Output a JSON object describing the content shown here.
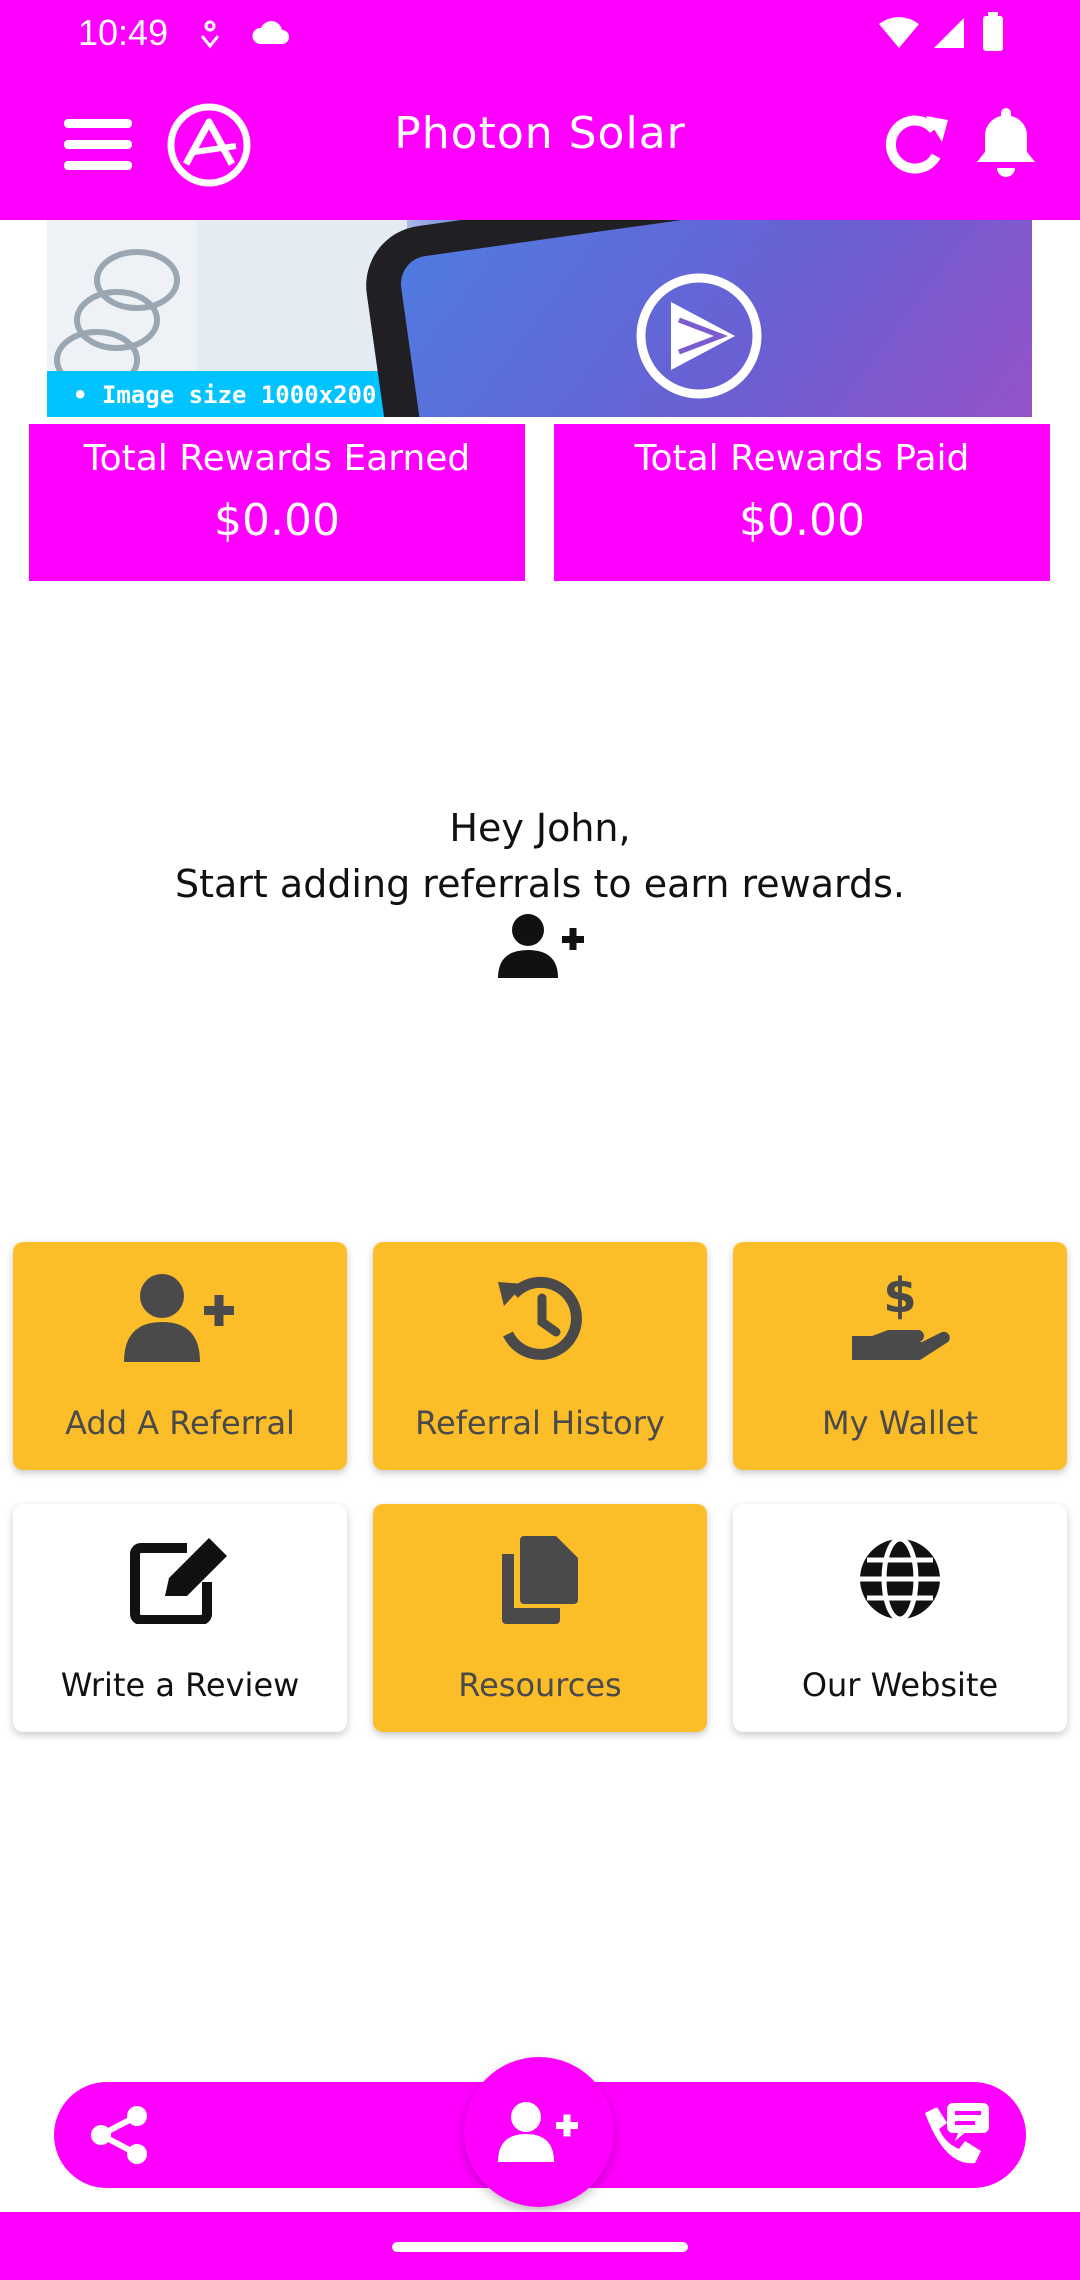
{
  "status_bar": {
    "time": "10:49"
  },
  "app_bar": {
    "title": "Photon Solar",
    "icons": [
      "menu-icon",
      "app-logo-icon",
      "refresh-icon",
      "bell-icon"
    ]
  },
  "banner": {
    "caption": "• Image size 1000x200"
  },
  "stats": [
    {
      "label": "Total Rewards Earned",
      "value": "$0.00"
    },
    {
      "label": "Total Rewards Paid",
      "value": "$0.00"
    }
  ],
  "greeting": {
    "line1": "Hey John,",
    "line2": "Start adding referrals to earn rewards."
  },
  "tiles": [
    {
      "label": "Add A Referral",
      "icon": "add-user-icon"
    },
    {
      "label": "Referral History",
      "icon": "history-icon"
    },
    {
      "label": "My Wallet",
      "icon": "wallet-hand-icon"
    },
    {
      "label": "Write a Review",
      "icon": "edit-icon"
    },
    {
      "label": "Resources",
      "icon": "documents-icon"
    },
    {
      "label": "Our Website",
      "icon": "globe-icon"
    }
  ],
  "bottom_nav": {
    "icons": [
      "share-icon",
      "add-user-icon",
      "contact-phone-icon"
    ]
  },
  "colors": {
    "brand": "#ff00ff",
    "tile_yellow": "#fbbd28",
    "tile_text": "#4a4a4a"
  }
}
